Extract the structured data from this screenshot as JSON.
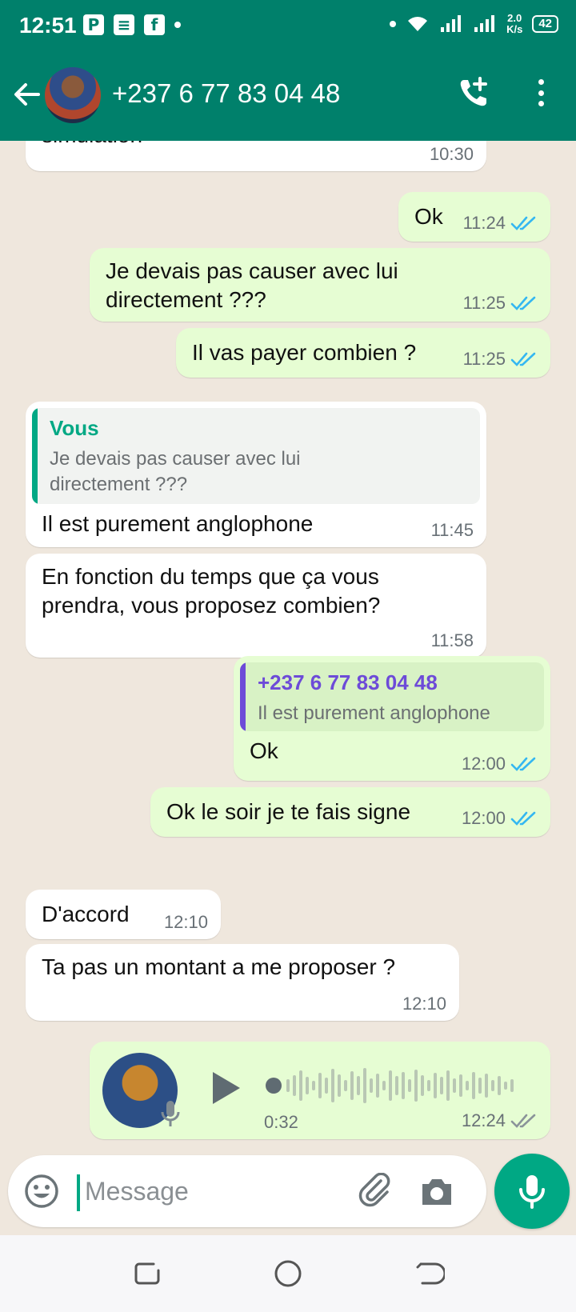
{
  "status_bar": {
    "time": "12:51",
    "app_icons": [
      "P",
      "≡",
      "f"
    ],
    "net_speed_value": "2.0",
    "net_speed_unit": "K/s",
    "battery": "42"
  },
  "header": {
    "contact_name": "+237 6 77 83 04 48",
    "icons": [
      "back-arrow-icon",
      "avatar",
      "add-call-icon",
      "more-vert-icon"
    ]
  },
  "messages": [
    {
      "dir": "in",
      "text": "simulation",
      "time": "10:30"
    },
    {
      "dir": "out",
      "text": "Ok",
      "time": "11:24",
      "read": true
    },
    {
      "dir": "out",
      "lines": [
        "Je devais pas causer avec lui",
        "directement ???"
      ],
      "time": "11:25",
      "read": true
    },
    {
      "dir": "out",
      "text": "Il vas payer combien ?",
      "time": "11:25",
      "read": true
    },
    {
      "dir": "in",
      "quote": {
        "author": "Vous",
        "lines": [
          "Je devais pas causer avec lui",
          "directement ???"
        ]
      },
      "text": "Il est purement anglophone",
      "time": "11:45"
    },
    {
      "dir": "in",
      "lines": [
        "En fonction du temps que ça vous",
        "prendra, vous proposez combien?"
      ],
      "time": "11:58"
    },
    {
      "dir": "out",
      "quote": {
        "author": "+237 6 77 83 04 48",
        "text": "Il est purement anglophone"
      },
      "text": "Ok",
      "time": "12:00",
      "read": true
    },
    {
      "dir": "out",
      "text": "Ok le soir je te fais signe",
      "time": "12:00",
      "read": true
    },
    {
      "dir": "in",
      "text": "D'accord",
      "time": "12:10"
    },
    {
      "dir": "in",
      "text": "Ta pas un montant a me proposer ?",
      "time": "12:10"
    },
    {
      "dir": "out",
      "type": "voice",
      "duration": "0:32",
      "time": "12:24",
      "read": false
    }
  ],
  "composer": {
    "placeholder": "Message"
  },
  "colors": {
    "header": "#00806b",
    "accent": "#00a884",
    "incoming": "#ffffff",
    "outgoing": "#e6fdd3",
    "read_ticks": "#34b7f1",
    "quote_self": "#00a884",
    "quote_contact": "#6d4bd8",
    "background": "#efe7dd"
  }
}
